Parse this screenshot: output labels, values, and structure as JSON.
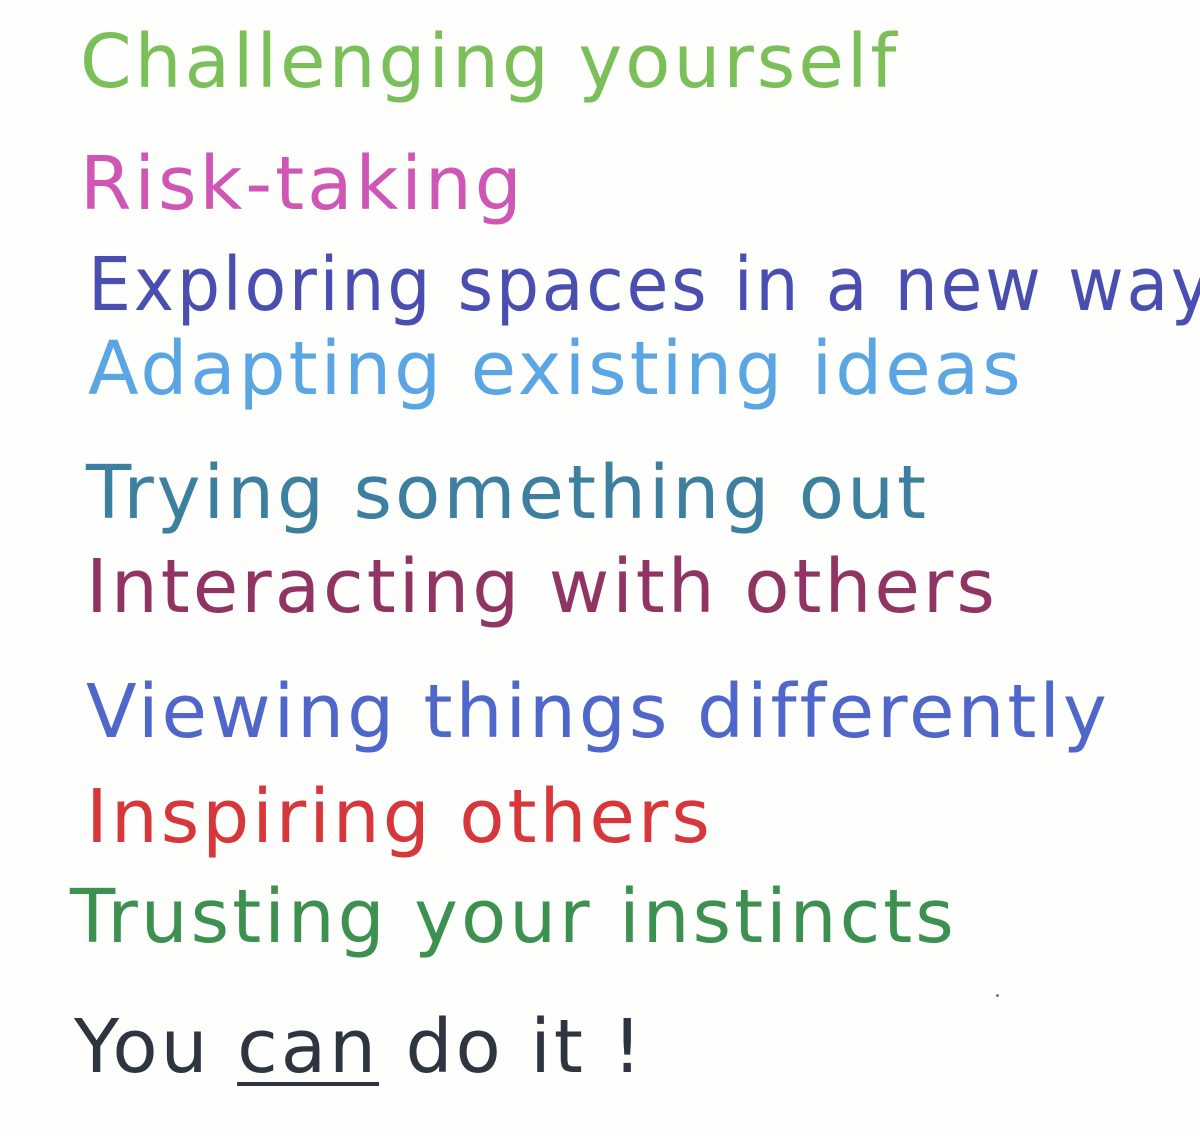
{
  "lines": [
    {
      "text": "Challenging yourself",
      "color": "#7bbf58"
    },
    {
      "text": "Risk-taking",
      "color": "#cf56b4"
    },
    {
      "text": "Exploring spaces in a new way",
      "color": "#4b4eb1"
    },
    {
      "text": "Adapting existing ideas",
      "color": "#5aa5e3"
    },
    {
      "text": "Trying something out",
      "color": "#3d7f9f"
    },
    {
      "text": "Interacting with others",
      "color": "#8f3463"
    },
    {
      "text": "Viewing things differently",
      "color": "#4f66ca"
    },
    {
      "text": "Inspiring others",
      "color": "#d7363a"
    },
    {
      "text": "Trusting your instincts",
      "color": "#3d9150"
    }
  ],
  "closing": {
    "before": "You ",
    "emphasis": "can",
    "after": " do it !",
    "color": "#2e3440"
  }
}
